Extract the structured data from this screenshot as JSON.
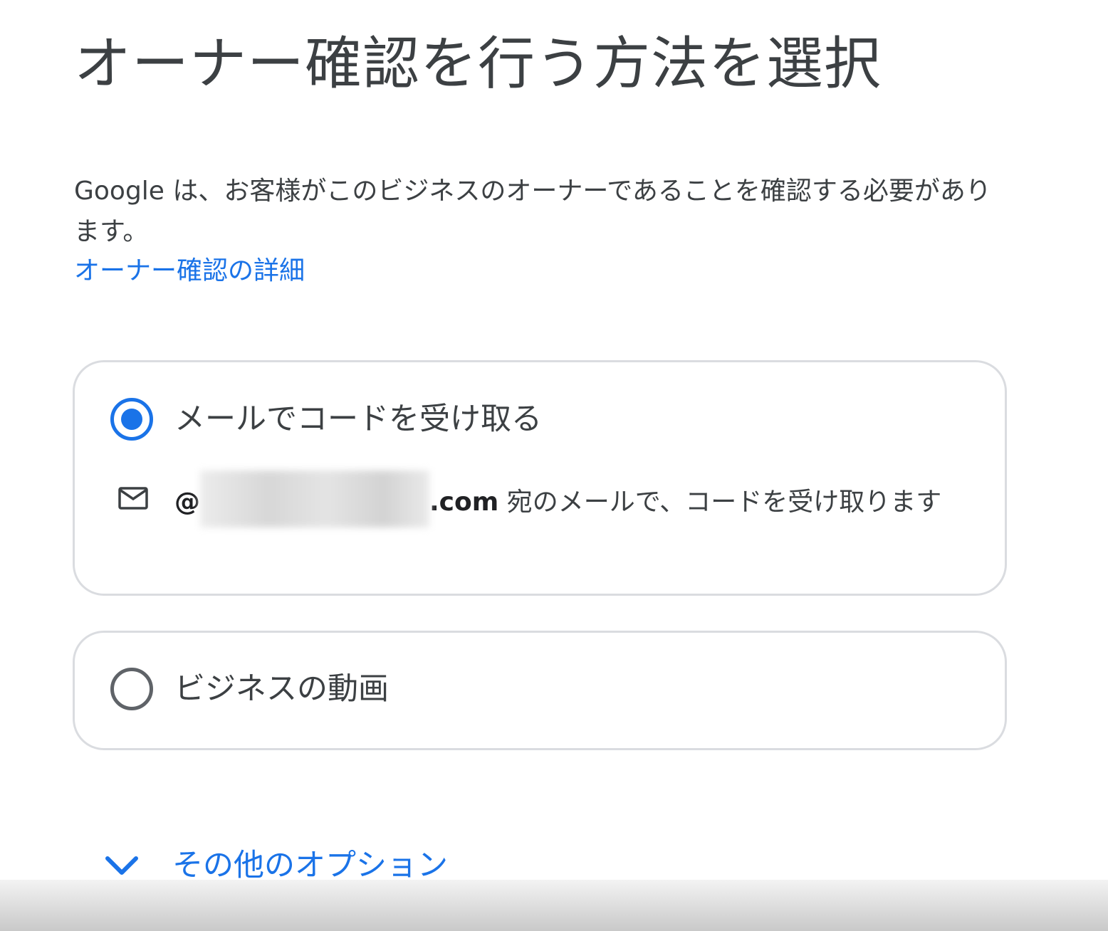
{
  "page": {
    "title": "オーナー確認を行う方法を選択",
    "description": "Google は、お客様がこのビジネスのオーナーであることを確認する必要があります。",
    "details_link": "オーナー確認の詳細"
  },
  "options": [
    {
      "label": "メールでコードを受け取る",
      "selected": true,
      "icon": "mail-icon",
      "detail": {
        "address_prefix": "@",
        "address_suffix": ".com",
        "text": " 宛のメールで、コードを受け取ります"
      }
    },
    {
      "label": "ビジネスの動画",
      "selected": false
    }
  ],
  "more_options": {
    "label": "その他のオプション",
    "icon": "chevron-down-icon"
  },
  "colors": {
    "accent": "#1a73e8",
    "text": "#3c4043",
    "border": "#dadce0"
  }
}
